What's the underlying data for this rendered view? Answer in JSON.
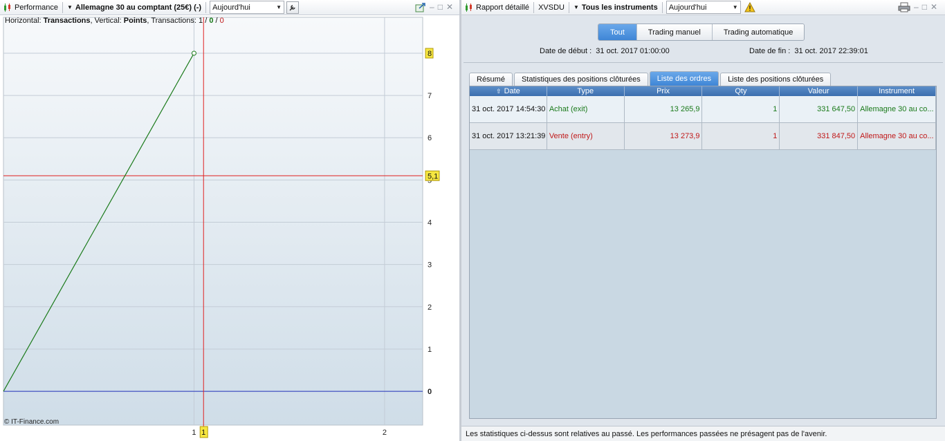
{
  "left_toolbar": {
    "performance_label": "Performance",
    "instrument_label": "Allemagne 30 au comptant (25€) (-)",
    "period_value": "Aujourd'hui"
  },
  "right_toolbar": {
    "report_label": "Rapport détaillé",
    "account_label": "XVSDU",
    "instruments_label": "Tous les instruments",
    "period_value": "Aujourd'hui"
  },
  "chart_info": {
    "h_prefix": "Horizontal: ",
    "h_value": "Transactions",
    "v_prefix": ", Vertical: ",
    "v_value": "Points",
    "t_prefix": ", Transactions: ",
    "t_total": "1",
    "t_sep1": " / ",
    "t_win": "0",
    "t_sep2": " / ",
    "t_loss": "0"
  },
  "chart_data": {
    "type": "line",
    "x": [
      0,
      1
    ],
    "values": [
      0,
      8
    ],
    "xlim": [
      0,
      2.2
    ],
    "ylim": [
      -0.8,
      8.85
    ],
    "x_ticks": [
      "1",
      "2"
    ],
    "y_ticks": [
      "0",
      "1",
      "2",
      "3",
      "4",
      "5",
      "6",
      "7",
      "8"
    ],
    "markers": {
      "y_last": "8",
      "y_cursor": "5,1",
      "x_cursor": "1"
    },
    "cursor": {
      "x": 1.05,
      "y": 5.1
    },
    "grid": true,
    "colors": {
      "line": "#1a7a1a",
      "zero": "#1f2fb8",
      "cursor": "#e02020",
      "marker": "#f6e640"
    }
  },
  "copyright": "© IT-Finance.com",
  "filters": {
    "all": "Tout",
    "manual": "Trading manuel",
    "auto": "Trading automatique"
  },
  "dates": {
    "start_label": "Date de début :",
    "start_value": "31 oct. 2017 01:00:00",
    "end_label": "Date de fin :",
    "end_value": "31 oct. 2017 22:39:01"
  },
  "tabs": [
    "Résumé",
    "Statistiques des positions clôturées",
    "Liste des ordres",
    "Liste des positions clôturées"
  ],
  "table": {
    "headers": [
      "Date",
      "Type",
      "Prix",
      "Qty",
      "Valeur",
      "Instrument"
    ],
    "rows": [
      [
        "31 oct. 2017 14:54:30",
        "Achat (exit)",
        "13 265,9",
        "1",
        "331 647,50",
        "Allemagne 30 au co..."
      ],
      [
        "31 oct. 2017 13:21:39",
        "Vente (entry)",
        "13 273,9",
        "1",
        "331 847,50",
        "Allemagne 30 au co..."
      ]
    ],
    "row_colors": [
      "#1a7a1a",
      "#c01818"
    ]
  },
  "footer": "Les statistiques ci-dessus sont relatives au passé. Les performances passées ne présagent pas de l'avenir."
}
